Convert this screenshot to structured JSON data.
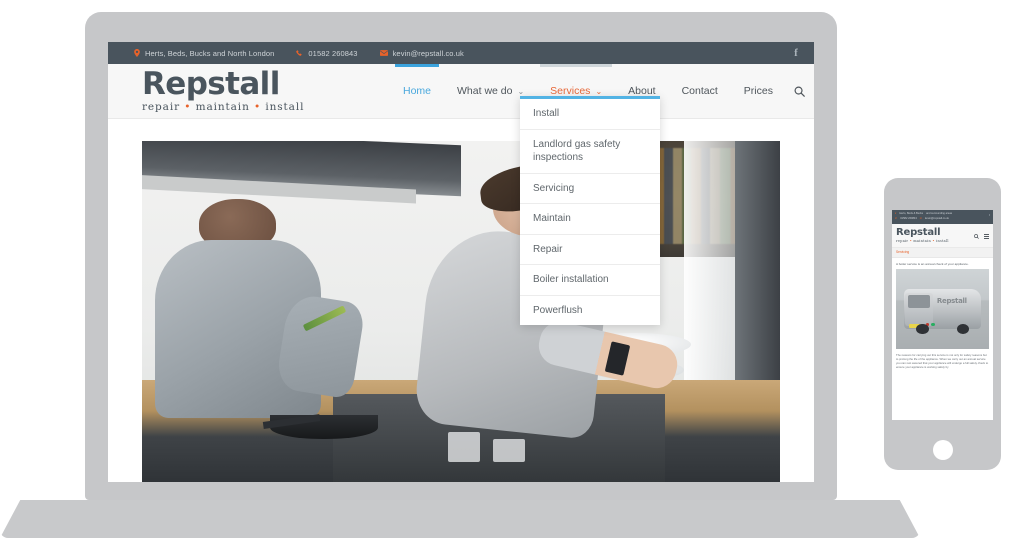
{
  "meta": {
    "scene": "Responsive website mockup shown on a laptop and a smartphone",
    "background_color": "#ffffff",
    "device_frame_color": "#c6c7c9"
  },
  "colors": {
    "topbar_bg": "#49545d",
    "accent_orange": "#e8622a",
    "accent_blue": "#3ba3dd",
    "dropdown_border": "#52b3e4",
    "header_bg": "#f7f7f7",
    "text_dark": "#4a555e"
  },
  "desktop": {
    "topbar": {
      "location": "Herts, Beds, Bucks and North London",
      "phone": "01582 260843",
      "email": "kevin@repstall.co.uk",
      "location_icon": "map-pin-icon",
      "phone_icon": "phone-icon",
      "email_icon": "envelope-icon",
      "social": {
        "facebook_label": "f",
        "icon": "facebook-icon"
      }
    },
    "logo": {
      "name": "Repstall",
      "tagline_1": "repair",
      "tagline_2": "maintain",
      "tagline_3": "install",
      "separator": "•"
    },
    "nav": {
      "items": [
        {
          "label": "Home",
          "state": "active",
          "chevron": ""
        },
        {
          "label": "What we do",
          "state": "default",
          "chevron": "⌄"
        },
        {
          "label": "Services",
          "state": "hover",
          "chevron": "⌄"
        },
        {
          "label": "About",
          "state": "default",
          "chevron": ""
        },
        {
          "label": "Contact",
          "state": "default",
          "chevron": ""
        },
        {
          "label": "Prices",
          "state": "default",
          "chevron": ""
        }
      ],
      "search_icon": "search-icon"
    },
    "services_dropdown": {
      "open": true,
      "items": [
        "Install",
        "Landlord gas safety inspections",
        "Servicing",
        "Maintain",
        "Repair",
        "Boiler installation",
        "Powerflush"
      ]
    },
    "hero": {
      "alt": "Man and woman working in a bright kitchen; woman rinsing dishes at the sink"
    }
  },
  "mobile": {
    "topbar": {
      "location": "Herts, Beds & Bucks",
      "extra": "and surrounding areas",
      "phone": "01582 260843",
      "email": "kevin@repstall.co.uk",
      "social": {
        "facebook_label": "f"
      }
    },
    "logo": {
      "name": "Repstall",
      "tagline_1": "repair",
      "tagline_2": "maintain",
      "tagline_3": "install",
      "separator": "•"
    },
    "tools": {
      "search_icon": "search-icon",
      "menu_icon": "hamburger-menu-icon"
    },
    "breadcrumb": "Servicing",
    "lead": "A boiler service is an annual check of your appliance.",
    "image_alt": "Silver Repstall branded van parked outside a house",
    "van_text": "Repstall",
    "body": "The reasons for carrying out this service is not only for safety reasons but to prolong the life of the appliance. When we carry out an annual service you can rest assured that your appliance will undergo a full safety check to ensure your appliance is working safely by"
  }
}
